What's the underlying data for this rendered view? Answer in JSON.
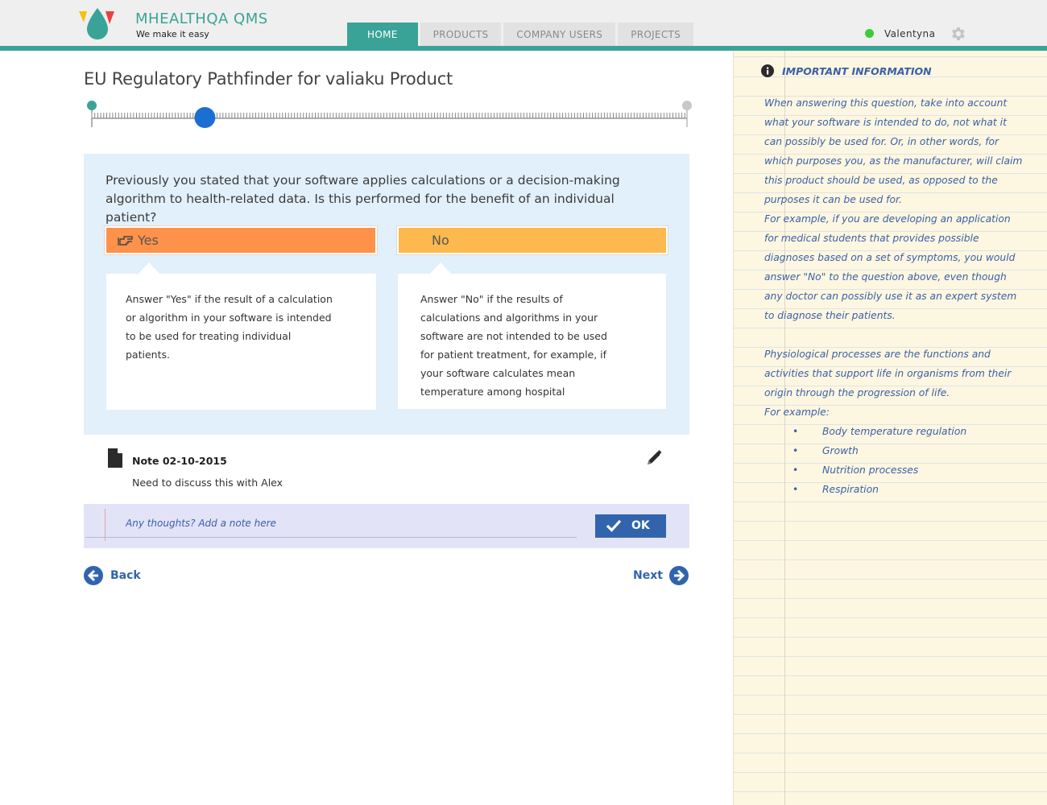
{
  "app": {
    "brand": "MHEALTHQA QMS",
    "tagline": "We make it easy"
  },
  "nav": {
    "tabs": [
      {
        "label": "HOME",
        "active": true
      },
      {
        "label": "PRODUCTS",
        "active": false
      },
      {
        "label": "COMPANY USERS",
        "active": false
      },
      {
        "label": "PROJECTS",
        "active": false
      }
    ]
  },
  "user": {
    "name": "Valentyna",
    "status_color": "#3bcc3b"
  },
  "main": {
    "title": "EU Regulatory Pathfinder for valiaku Product",
    "progress_fraction": 0.19,
    "question": "Previously you stated that your software applies calculations or a decision-making algorithm to health-related data. Is this performed for the benefit of an individual patient?",
    "answers": {
      "yes": {
        "label": "Yes",
        "description": "Answer \"Yes\" if the result of a calculation or algorithm in your software is intended to be used for treating individual patients."
      },
      "no": {
        "label": "No",
        "description": "Answer \"No\" if the results of calculations and algorithms in your software are not intended to be used for patient treatment, for example, if your software calculates mean temperature among hospital"
      }
    },
    "note": {
      "title": "Note 02-10-2015",
      "text": "Need to discuss this with Alex"
    },
    "note_input": {
      "placeholder": "Any thoughts? Add a note here",
      "value": ""
    },
    "ok_label": "OK",
    "back_label": "Back",
    "next_label": "Next"
  },
  "sidebar": {
    "title": "IMPORTANT INFORMATION",
    "para1": "When answering this question, take into account what your software is intended to do, not what it can possibly be used for. Or, in other words, for which purposes you, as the manufacturer, will claim this product should be used, as opposed to the purposes it can be used for.",
    "para2": "For example, if you are developing an application for medical students that provides possible diagnoses based on a set of symptoms, you would answer \"No\" to the question above, even though any doctor can possibly use it as an expert system to diagnose their patients.",
    "para3": "Physiological processes are the functions and activities that support life in organisms from their origin through the progression of life.",
    "para4": "For example:",
    "examples": [
      "Body temperature regulation",
      "Growth",
      "Nutrition processes",
      "Respiration"
    ]
  },
  "colors": {
    "accent": "#3aa397",
    "primary_blue": "#3164ad",
    "yes_orange": "#ff924a",
    "no_orange": "#fdb94d",
    "question_bg": "#e2f0fb",
    "notebook_bg": "#fdf7e1"
  },
  "icons": {
    "logo": "logo-drops",
    "settings": "gear-icon",
    "choice": "pointing-hand-icon",
    "note": "document-icon",
    "edit": "pencil-icon",
    "confirm": "check-icon",
    "back": "arrow-left-circle-icon",
    "next": "arrow-right-circle-icon",
    "info": "info-icon"
  }
}
